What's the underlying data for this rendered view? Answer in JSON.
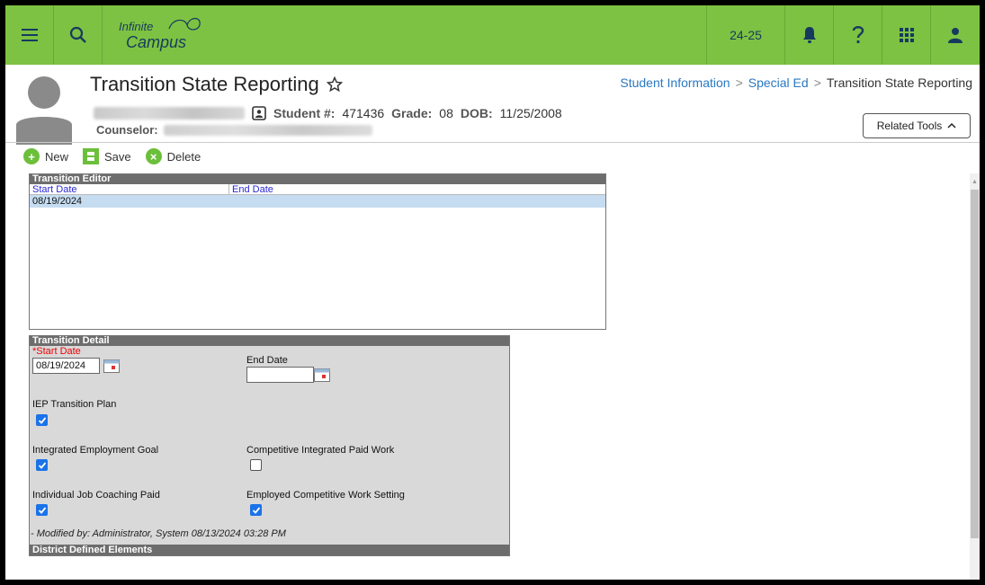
{
  "app": {
    "logo_line1": "Infinite",
    "logo_line2": "Campus",
    "school_year": "24-25"
  },
  "header": {
    "title": "Transition State Reporting",
    "breadcrumb": [
      "Student Information",
      "Special Ed",
      "Transition State Reporting"
    ],
    "student_number_label": "Student #:",
    "student_number": "471436",
    "grade_label": "Grade:",
    "grade": "08",
    "dob_label": "DOB:",
    "dob": "11/25/2008",
    "counselor_label": "Counselor:",
    "related_tools_label": "Related Tools"
  },
  "toolbar": {
    "new_label": "New",
    "save_label": "Save",
    "delete_label": "Delete"
  },
  "editor": {
    "title": "Transition Editor",
    "columns": [
      "Start Date",
      "End Date"
    ],
    "rows": [
      {
        "start": "08/19/2024",
        "end": ""
      }
    ]
  },
  "detail": {
    "title": "Transition Detail",
    "start_date_label": "Start Date",
    "start_date_required_marker": "*",
    "start_date_value": "08/19/2024",
    "end_date_label": "End Date",
    "end_date_value": "",
    "iep_transition_plan_label": "IEP Transition Plan",
    "iep_transition_plan": true,
    "integrated_employment_goal_label": "Integrated Employment Goal",
    "integrated_employment_goal": true,
    "competitive_integrated_paid_work_label": "Competitive Integrated Paid Work",
    "competitive_integrated_paid_work": false,
    "individual_job_coaching_paid_label": "Individual Job Coaching Paid",
    "individual_job_coaching_paid": true,
    "employed_competitive_work_setting_label": "Employed Competitive Work Setting",
    "employed_competitive_work_setting": true,
    "modified_by": "- Modified by: Administrator, System 08/13/2024 03:28 PM",
    "district_defined_title": "District Defined Elements"
  },
  "colors": {
    "topbar": "#7dc242",
    "link": "#2a78c2",
    "panel_header": "#6d6d6d",
    "checkbox_on": "#1a73e8",
    "selected_row": "#c5dcf1"
  }
}
